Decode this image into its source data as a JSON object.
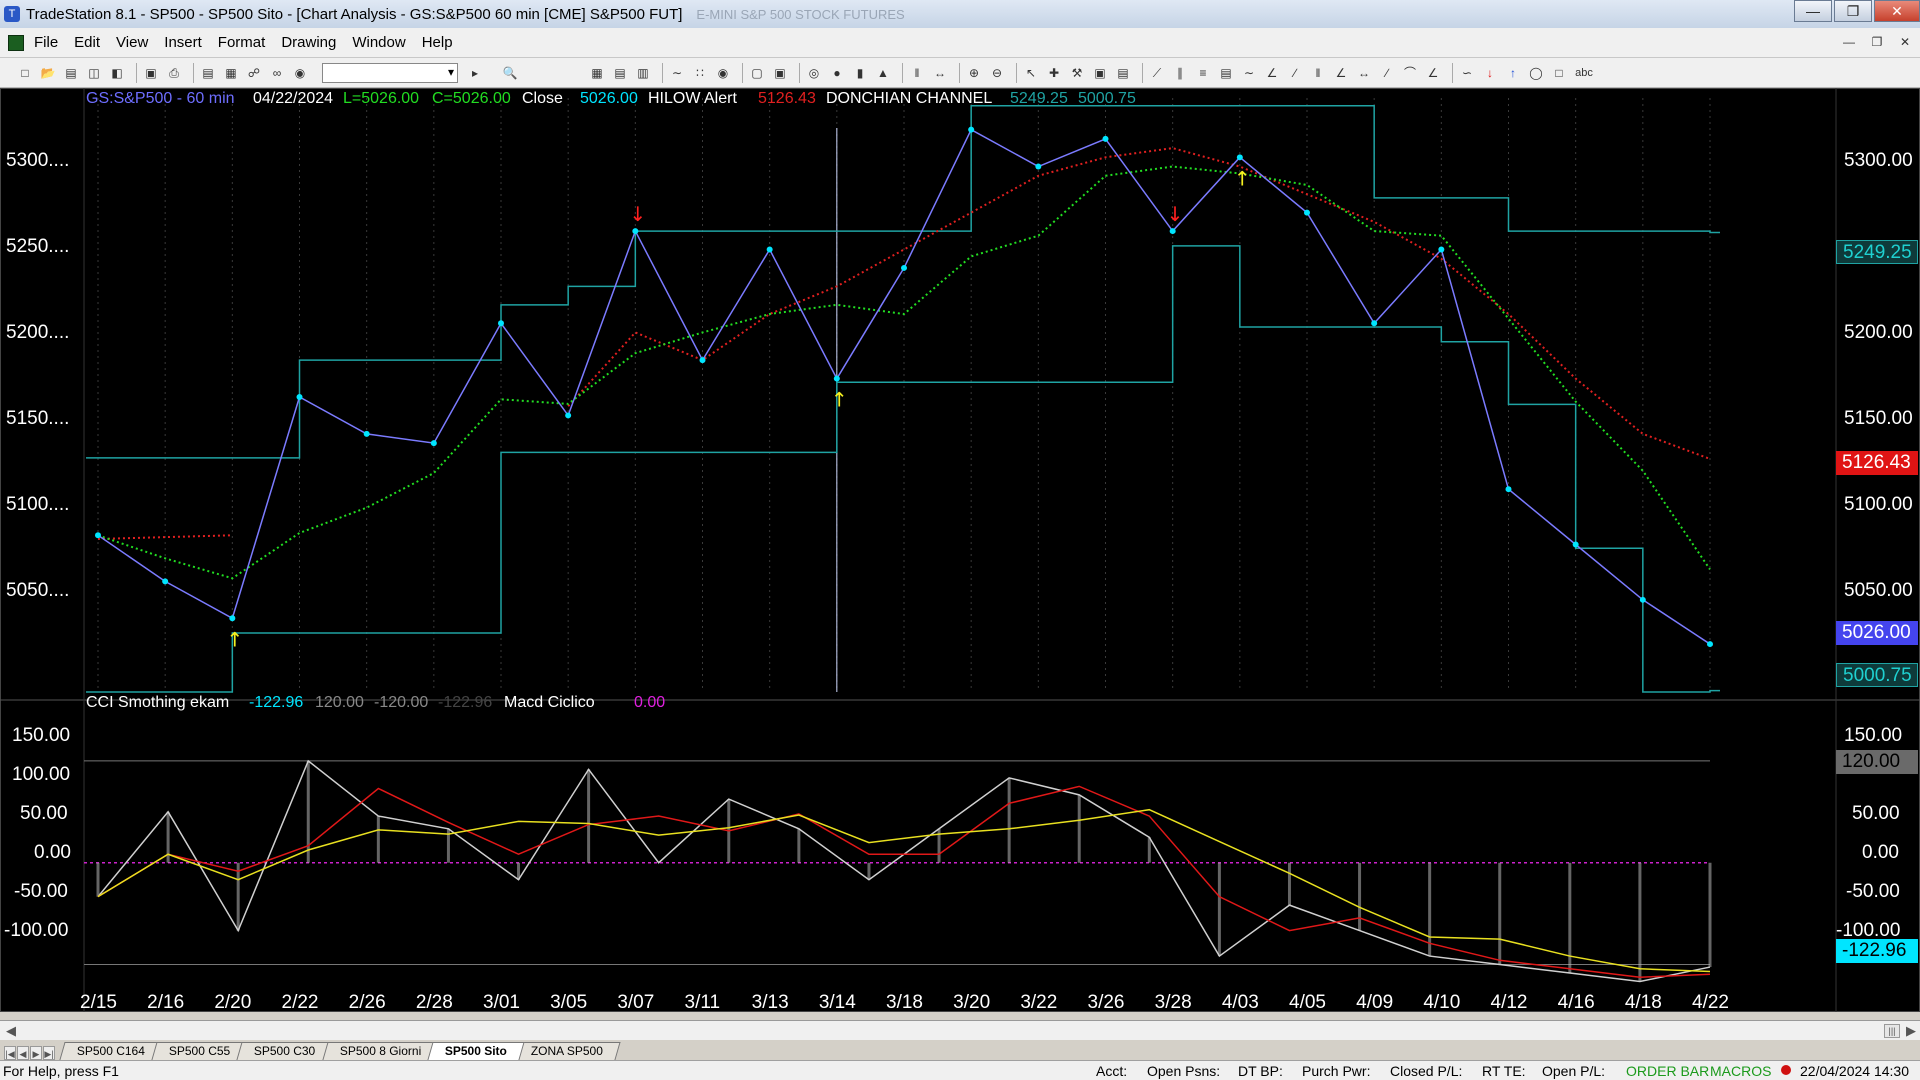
{
  "window": {
    "title": "TradeStation 8.1 - SP500 - SP500 Sito - [Chart Analysis - GS:S&P500  60 min  [CME] S&P500 FUT]",
    "ghost_text": "E-MINI S&P 500 STOCK FUTURES"
  },
  "menu": [
    "File",
    "Edit",
    "View",
    "Insert",
    "Format",
    "Drawing",
    "Window",
    "Help"
  ],
  "price_header": {
    "symbol": "GS:S&P500 - 60 min",
    "date": "04/22/2024",
    "low": "L=5026.00",
    "close": "C=5026.00",
    "close_label": "Close",
    "close_value": "5026.00",
    "hilow_label": "HILOW Alert",
    "hilow_value": "5126.43",
    "donchian_label": "DONCHIAN CHANNEL",
    "donchian_upper": "5249.25",
    "donchian_lower": "5000.75"
  },
  "price_axis_left": [
    "5300....",
    "5250....",
    "5200....",
    "5150....",
    "5100....",
    "5050...."
  ],
  "price_axis_right": [
    "5300.00",
    "5250.00",
    "5200.00",
    "5150.00",
    "5100.00",
    "5050.00"
  ],
  "price_badges": {
    "donchian_upper": "5249.25",
    "hilow": "5126.43",
    "close": "5026.00",
    "donchian_lower": "5000.75"
  },
  "osc_header": {
    "cci_label": "CCI Smothing ekam",
    "cci_value": "-122.96",
    "upper_level": "120.00",
    "lower_level": "-120.00",
    "cci_dim": "-122.96",
    "macd_label": "Macd Ciclico",
    "macd_value": "0.00"
  },
  "osc_axis_left": [
    "150.00",
    "100.00",
    "50.00",
    "0.00",
    "-50.00",
    "-100.00"
  ],
  "osc_axis_right": [
    "150.00",
    "100.00",
    "50.00",
    "0.00",
    "-50.00",
    "-100.00"
  ],
  "osc_badges": {
    "upper": "120.00",
    "cci": "-122.96"
  },
  "date_axis": [
    "2/15",
    "2/16",
    "2/20",
    "2/22",
    "2/26",
    "2/28",
    "3/01",
    "3/05",
    "3/07",
    "3/11",
    "3/13",
    "3/14",
    "3/18",
    "3/20",
    "3/22",
    "3/26",
    "3/28",
    "4/03",
    "4/05",
    "4/09",
    "4/10",
    "4/12",
    "4/16",
    "4/18",
    "4/22"
  ],
  "tabs": [
    "SP500 C164",
    "SP500 C55",
    "SP500 C30",
    "SP500 8 Giorni",
    "SP500 Sito",
    "ZONA SP500"
  ],
  "active_tab": "SP500 Sito",
  "status": {
    "help": "For Help, press F1",
    "acct": "Acct:",
    "open_psns": "Open Psns:",
    "dt_bp": "DT BP:",
    "purch_pwr": "Purch Pwr:",
    "closed_pl": "Closed P/L:",
    "rt_te": "RT TE:",
    "open_pl": "Open P/L:",
    "order_bar": "ORDER BAR",
    "macros": "MACROS",
    "datetime": "22/04/2024 14:30"
  },
  "colors": {
    "price_line": "#7b7bff",
    "price_dots": "#00e5ff",
    "donchian": "#1fa3a3",
    "hilow": "#e02020",
    "ma_green": "#22dd22",
    "cci_hist": "#b8b8b8",
    "osc_red": "#e01818",
    "osc_yellow": "#e8e020",
    "zero_line": "#cc22cc",
    "badge_blue": "#4444ee",
    "badge_red": "#e01414"
  },
  "chart_data": [
    {
      "type": "line",
      "series": [
        {
          "name": "GS:S&P500 - 60 min",
          "x": [
            "2/15",
            "2/16",
            "2/20",
            "2/22",
            "2/26",
            "2/28",
            "3/01",
            "3/05",
            "3/07",
            "3/11",
            "3/13",
            "3/14",
            "3/18",
            "3/20",
            "3/22",
            "3/26",
            "3/28",
            "4/03",
            "4/05",
            "4/09",
            "4/10",
            "4/12",
            "4/16",
            "4/18",
            "4/22"
          ],
          "values": [
            5085,
            5060,
            5040,
            5160,
            5140,
            5135,
            5200,
            5150,
            5250,
            5180,
            5240,
            5170,
            5230,
            5305,
            5285,
            5300,
            5250,
            5290,
            5260,
            5200,
            5240,
            5110,
            5080,
            5050,
            5026
          ]
        },
        {
          "name": "DONCHIAN CHANNEL",
          "upper": [
            5127,
            5127,
            5127,
            5180,
            5180,
            5180,
            5210,
            5220,
            5250,
            5250,
            5250,
            5250,
            5250,
            5318,
            5318,
            5318,
            5318,
            5318,
            5318,
            5268,
            5268,
            5250,
            5250,
            5250,
            5249.25
          ],
          "lower": [
            5000,
            5000,
            5032,
            5032,
            5032,
            5032,
            5130,
            5130,
            5130,
            5130,
            5130,
            5168,
            5168,
            5168,
            5168,
            5168,
            5242,
            5198,
            5198,
            5198,
            5190,
            5156,
            5078,
            5000,
            5000.75
          ]
        },
        {
          "name": "HILOW Alert",
          "values": [
            5083,
            5084,
            5085,
            null,
            null,
            null,
            null,
            5155,
            5195,
            5180,
            5205,
            5220,
            5240,
            5260,
            5280,
            5290,
            5295,
            5285,
            5270,
            5255,
            5235,
            5205,
            5170,
            5140,
            5126.43
          ]
        }
      ],
      "ylim": [
        5000,
        5320
      ]
    },
    {
      "type": "line",
      "series": [
        {
          "name": "CCI Smothing ekam",
          "values": [
            -40,
            60,
            -80,
            120,
            55,
            40,
            -20,
            110,
            0,
            75,
            40,
            -20,
            40,
            100,
            80,
            30,
            -110,
            -50,
            -80,
            -110,
            -120,
            -130,
            -140,
            -122.96
          ]
        },
        {
          "name": "Macd Ciclico",
          "values": [
            0,
            0,
            0,
            0,
            0,
            0,
            0,
            0,
            0,
            0,
            0,
            0,
            0,
            0,
            0,
            0,
            0,
            0,
            0,
            0,
            0,
            0,
            0,
            0
          ]
        }
      ],
      "ylim": [
        -150,
        180
      ],
      "levels": [
        120,
        -120
      ]
    }
  ]
}
